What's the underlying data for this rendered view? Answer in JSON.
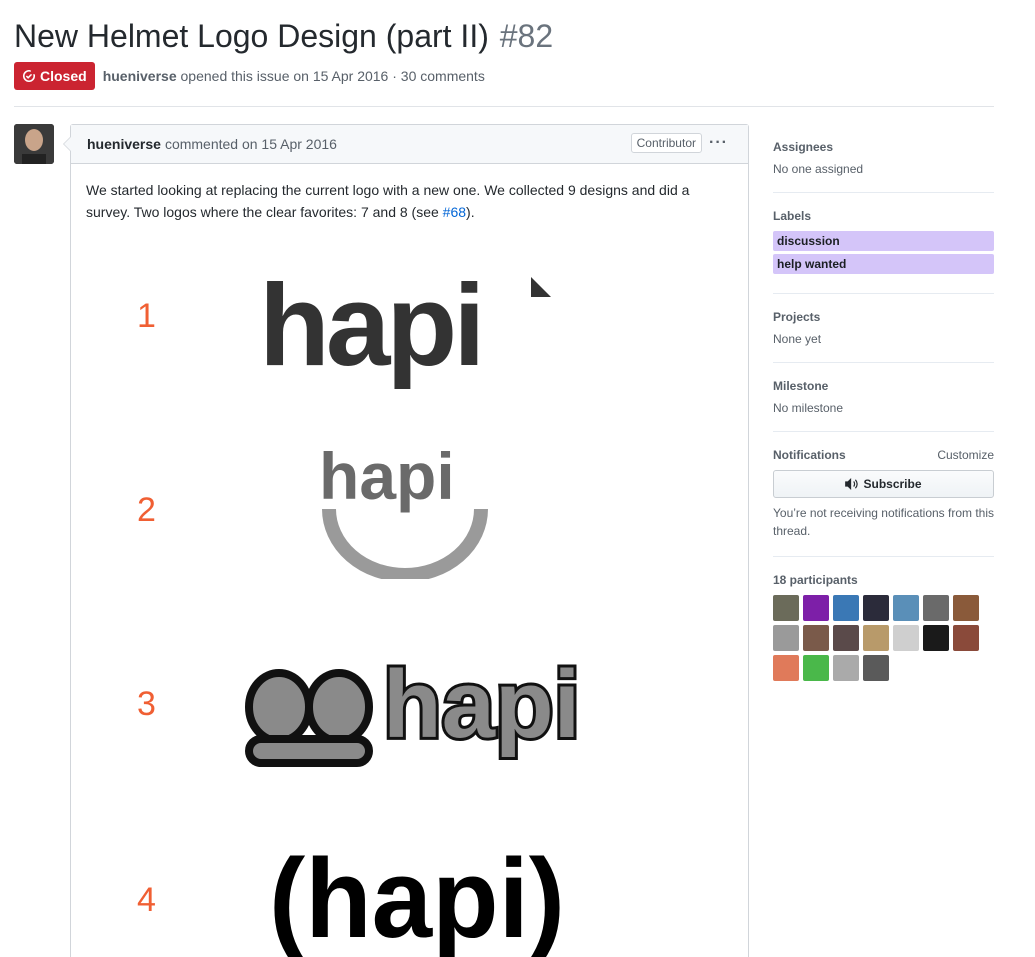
{
  "issue": {
    "title": "New Helmet Logo Design (part II)",
    "number": "#82",
    "state": "Closed",
    "author": "hueniverse",
    "meta_rest": "opened this issue on 15 Apr 2016 · 30 comments"
  },
  "comment": {
    "author": "hueniverse",
    "timestamp": "commented on 15 Apr 2016",
    "role_badge": "Contributor",
    "menu_icon": "kebab-icon",
    "body_prefix": "We started looking at replacing the current logo with a new one. We collected 9 designs and did a survey. Two logos where the clear favorites: 7 and 8 (see ",
    "body_link": "#68",
    "body_suffix": ").",
    "logos": [
      {
        "number": "1",
        "text": "hapi"
      },
      {
        "number": "2",
        "text": "hapi"
      },
      {
        "number": "3",
        "text": "hapi"
      },
      {
        "number": "4",
        "text": "(hapi)"
      }
    ]
  },
  "sidebar": {
    "assignees": {
      "heading": "Assignees",
      "value": "No one assigned"
    },
    "labels": {
      "heading": "Labels",
      "items": [
        "discussion",
        "help wanted"
      ],
      "color": "#d4c5f9"
    },
    "projects": {
      "heading": "Projects",
      "value": "None yet"
    },
    "milestone": {
      "heading": "Milestone",
      "value": "No milestone"
    },
    "notifications": {
      "heading": "Notifications",
      "customize": "Customize",
      "button": "Subscribe",
      "help": "You’re not receiving notifications from this thread."
    },
    "participants": {
      "heading": "18 participants",
      "avatars": [
        "#6b6b5a",
        "#7d1fa8",
        "#3a78b5",
        "#2b2b3a",
        "#5a8fb8",
        "#6a6a6a",
        "#8a5a3a",
        "#9a9a9a",
        "#7a5a4a",
        "#5a4a4a",
        "#b89a6a",
        "#cfcfcf",
        "#1a1a1a",
        "#8a4a3a",
        "#e07a5a",
        "#4ab84a",
        "#aaaaaa",
        "#5a5a5a"
      ]
    }
  },
  "colors": {
    "closed_badge": "#cb2431",
    "link": "#0366d6",
    "logo_number": "#f05f33"
  }
}
